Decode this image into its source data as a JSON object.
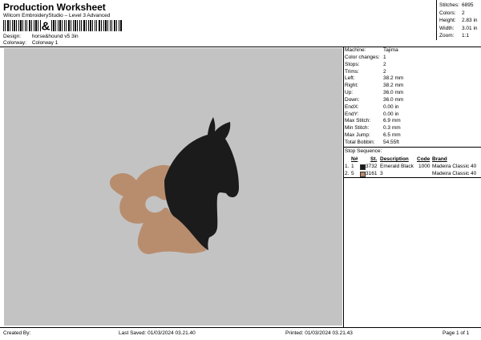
{
  "header": {
    "title": "Production Worksheet",
    "subtitle": "Wilcom EmbroideryStudio – Level 3 Advanced",
    "barcode_text": "&",
    "design_label": "Design:",
    "design_value": "horse&hound v5 3in",
    "colorway_label": "Colorway:",
    "colorway_value": "Colorway 1"
  },
  "stats": [
    {
      "label": "Stitches:",
      "value": "6895"
    },
    {
      "label": "Colors:",
      "value": "2"
    },
    {
      "label": "Height:",
      "value": "2.83 in"
    },
    {
      "label": "Width:",
      "value": "3.01 in"
    },
    {
      "label": "Zoom:",
      "value": "1:1"
    }
  ],
  "machine": [
    {
      "label": "Machine:",
      "value": "Tajima"
    },
    {
      "label": "Color changes:",
      "value": "1"
    },
    {
      "label": "Stops:",
      "value": "2"
    },
    {
      "label": "Trims:",
      "value": "2"
    },
    {
      "label": "Left:",
      "value": "38.2 mm"
    },
    {
      "label": "Right:",
      "value": "38.2 mm"
    },
    {
      "label": "Up:",
      "value": "36.0 mm"
    },
    {
      "label": "Down:",
      "value": "36.0 mm"
    },
    {
      "label": "EndX:",
      "value": "0.00 in"
    },
    {
      "label": "EndY:",
      "value": "0.00 in"
    },
    {
      "label": "Max Stitch:",
      "value": "6.9 mm"
    },
    {
      "label": "Min Stitch:",
      "value": "0.3 mm"
    },
    {
      "label": "Max Jump:",
      "value": "6.5 mm"
    },
    {
      "label": "Total Bobbin:",
      "value": "54.55ft"
    }
  ],
  "stop_sequence": {
    "title": "Stop Sequence:",
    "headers": {
      "num": "N#",
      "st": "St.",
      "description": "Description",
      "code": "Code",
      "brand": "Brand"
    },
    "rows": [
      {
        "index": "1.",
        "num": "1",
        "color": "#1a1a1a",
        "st": "3732",
        "description": "Emerald Black",
        "code": "1000",
        "brand": "Madeira Classic 40"
      },
      {
        "index": "2.",
        "num": "5",
        "color": "#b5896a",
        "st": "3161",
        "description": "3",
        "code": "",
        "brand": "Madeira Classic 40"
      }
    ]
  },
  "design_colors": {
    "horse": "#1b1b1b",
    "hound": "#b88d6e",
    "canvas": "#c3c3c3"
  },
  "footer": {
    "created_by": "Created By:",
    "last_saved": "Last Saved: 01/03/2024 03.21.40",
    "printed": "Printed: 01/03/2024 03.21.43",
    "page": "Page 1 of 1"
  }
}
